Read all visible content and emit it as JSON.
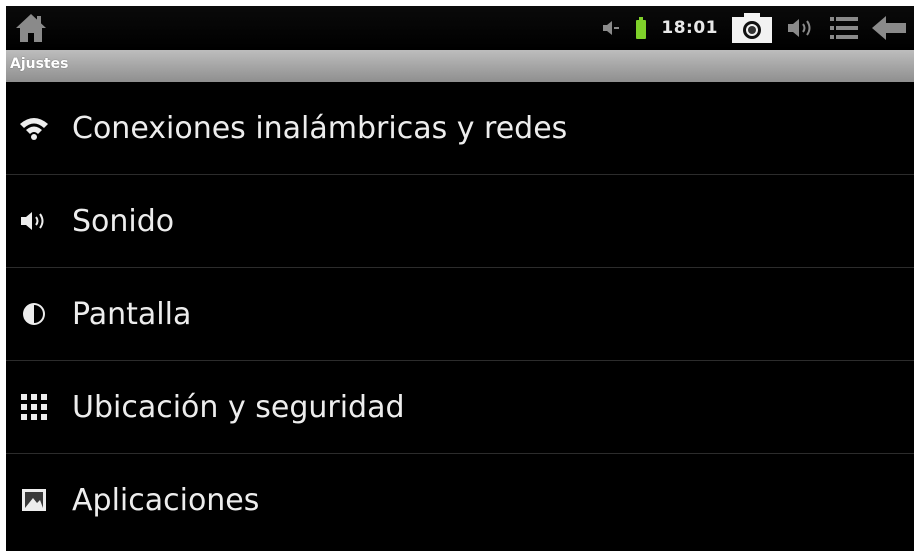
{
  "statusbar": {
    "time": "18:01",
    "icons": [
      "home-icon",
      "volume-mute-icon",
      "battery-icon",
      "camera-icon",
      "volume-icon",
      "menu-icon",
      "back-icon"
    ]
  },
  "titlebar": {
    "title": "Ajustes"
  },
  "settings": {
    "items": [
      {
        "label": "Conexiones inalámbricas y redes",
        "icon": "wifi-icon"
      },
      {
        "label": "Sonido",
        "icon": "speaker-icon"
      },
      {
        "label": "Pantalla",
        "icon": "brightness-icon"
      },
      {
        "label": "Ubicación y seguridad",
        "icon": "location-grid-icon"
      },
      {
        "label": "Aplicaciones",
        "icon": "applications-icon"
      }
    ]
  },
  "colors": {
    "background": "#000000",
    "titlebar": "#a6a6a6",
    "text": "#ededed",
    "battery": "#7fd12a"
  }
}
